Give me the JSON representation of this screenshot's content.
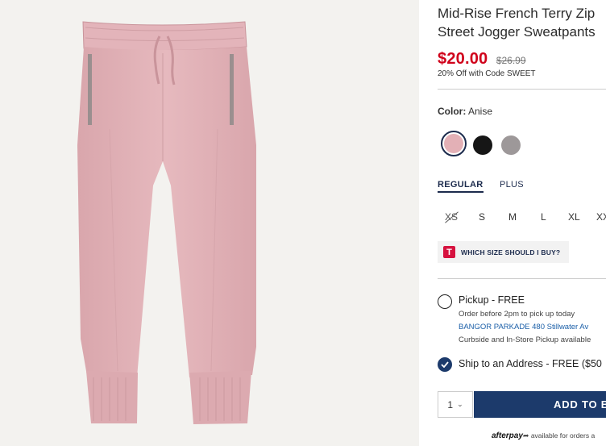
{
  "product": {
    "title_line1": "Mid-Rise French Terry Zip",
    "title_line2": "Street Jogger Sweatpants",
    "price_now": "$20.00",
    "price_was": "$26.99",
    "promo": "20% Off with Code SWEET"
  },
  "color": {
    "label": "Color:",
    "selected": "Anise",
    "swatches": [
      {
        "name": "Anise",
        "hex": "#e3b0b6",
        "selected": true
      },
      {
        "name": "black",
        "hex": "#161616",
        "selected": false
      },
      {
        "name": "heather gray",
        "hex": "#9d9899",
        "selected": false
      }
    ]
  },
  "fit": {
    "tabs": [
      "REGULAR",
      "PLUS"
    ],
    "active": "REGULAR"
  },
  "sizes": [
    "XS",
    "S",
    "M",
    "L",
    "XL",
    "XX"
  ],
  "size_guide": {
    "badge": "T",
    "label": "WHICH SIZE SHOULD I BUY?"
  },
  "fulfillment": {
    "pickup_title": "Pickup - FREE",
    "pickup_line1": "Order before 2pm to pick up today",
    "pickup_store": "BANGOR PARKADE 480 Stillwater Av",
    "pickup_line3": "Curbside and In-Store Pickup available",
    "ship_title": "Ship to an Address - FREE ($50"
  },
  "cart": {
    "qty": "1",
    "add_label": "ADD TO B"
  },
  "afterpay": {
    "logo": "afterpay",
    "text": "available for orders a"
  },
  "colors": {
    "accent": "#1c3a6b",
    "sale": "#d0021b",
    "pant": "#e2b3b8"
  }
}
